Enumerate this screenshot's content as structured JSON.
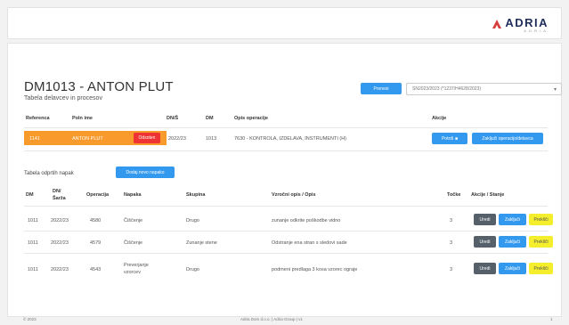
{
  "brand": {
    "name": "ADRIA",
    "tagline": "A.D.R.I.A."
  },
  "page": {
    "title": "DM1013 - ANTON PLUT",
    "subtitle": "Tabela delavcev in procesov",
    "top_button": "Prenesi",
    "select_value": "SN2023/2023 (*1237/H4628/2023)"
  },
  "table1": {
    "headers": [
      "Referenca",
      "Poln ime",
      "DN/Š",
      "DM",
      "Opis operacije",
      "Akcije"
    ],
    "row": {
      "ref": "1141",
      "name": "ANTON PLUT",
      "status": "Odsoten",
      "dn": "2022/23",
      "dm": "1013",
      "desc": "7630 - KONTROLA, IZDELAVA, INSTRUMENTI (H)",
      "btn1": "Potrdi",
      "btn2": "Zaključi operacijo/delavca"
    }
  },
  "table2": {
    "title": "Tabela odprtih napak",
    "add_button": "Dodaj novo napako",
    "headers": [
      "DM",
      "DN/ Šarža",
      "Operacija",
      "Napaka",
      "Skupina",
      "Vzročni opis / Opis",
      "Točke",
      "Akcije / Stanje"
    ],
    "rows": [
      {
        "dm": "1011",
        "dn": "2022/23",
        "op": "4580",
        "napaka": "Čiščenje",
        "skupina": "Drugo",
        "opis": "zunanje odkrite poškodbe vidno",
        "tocke": "3"
      },
      {
        "dm": "1011",
        "dn": "2022/23",
        "op": "4579",
        "napaka": "Čiščenje",
        "skupina": "Zunanje stene",
        "opis": "Odstranje ena stran s sledovi sade",
        "tocke": "3"
      },
      {
        "dm": "1011",
        "dn": "2022/23",
        "op": "4543",
        "napaka": "Preverjanje vzorcev",
        "skupina": "Drugo",
        "opis": "podmeni predlaga 3 kosa vzorec ograje",
        "tocke": "3"
      }
    ],
    "actions": {
      "gray": "Uredi",
      "blue": "Zaključi",
      "yellow": "Prekliči"
    }
  },
  "footer": {
    "left": "© 2023",
    "center": "Adria Dom d.o.o. | Adria Group | v1",
    "right": "1"
  },
  "colors": {
    "accent": "#3399ee",
    "highlight": "#f89a2c",
    "danger": "#ee3333",
    "warning": "#f4ee2c",
    "logo_red": "#d83b3b",
    "logo_navy": "#1f2d5a"
  }
}
